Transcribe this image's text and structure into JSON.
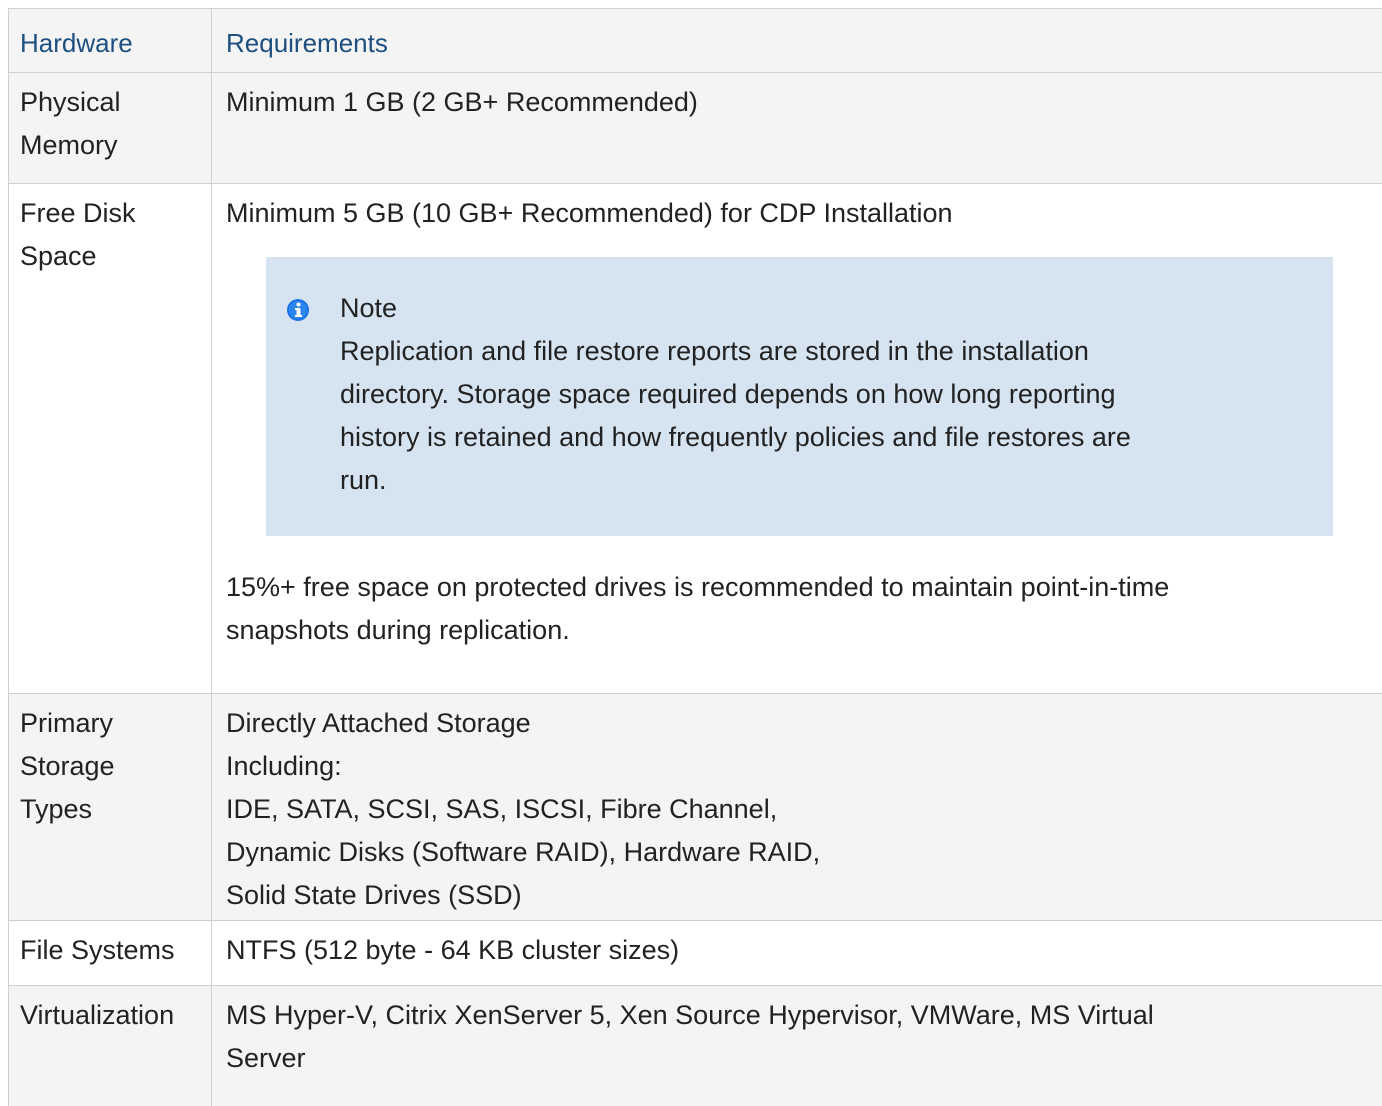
{
  "table": {
    "headers": {
      "hardware": "Hardware",
      "requirements": "Requirements"
    },
    "rows": {
      "memory": {
        "hardware": [
          "Physical",
          "Memory"
        ],
        "requirement": "Minimum 1 GB (2 GB+ Recommended)"
      },
      "disk": {
        "hardware": [
          "Free Disk",
          "Space"
        ],
        "requirement": "Minimum 5 GB (10 GB+ Recommended) for CDP Installation",
        "note": {
          "icon": "info-icon",
          "title": "Note",
          "lines": [
            "Replication and file restore reports are stored in the installation",
            "directory. Storage space required depends on how long reporting",
            "history is retained and how frequently policies and file restores are",
            "run."
          ]
        },
        "extra_lines": [
          "15%+ free space on protected drives is recommended to maintain point-in-time",
          "snapshots during replication."
        ]
      },
      "storage": {
        "hardware": [
          "Primary",
          "Storage",
          "Types"
        ],
        "lines": [
          "Directly Attached Storage",
          "Including:",
          "IDE, SATA, SCSI, SAS, ISCSI, Fibre Channel,",
          "Dynamic Disks (Software RAID), Hardware RAID,",
          "Solid State Drives (SSD)"
        ]
      },
      "filesystems": {
        "hardware": "File Systems",
        "requirement": "NTFS (512 byte - 64 KB cluster sizes)"
      },
      "virtualization": {
        "hardware": "Virtualization",
        "lines": [
          "MS Hyper-V, Citrix XenServer 5, Xen Source Hypervisor, VMWare, MS Virtual",
          "Server"
        ]
      }
    }
  },
  "colors": {
    "header_text": "#1d4f80",
    "stripe": "#f4f4f4",
    "note_bg": "#d6e3f1",
    "info_icon": "#1a73e8"
  }
}
